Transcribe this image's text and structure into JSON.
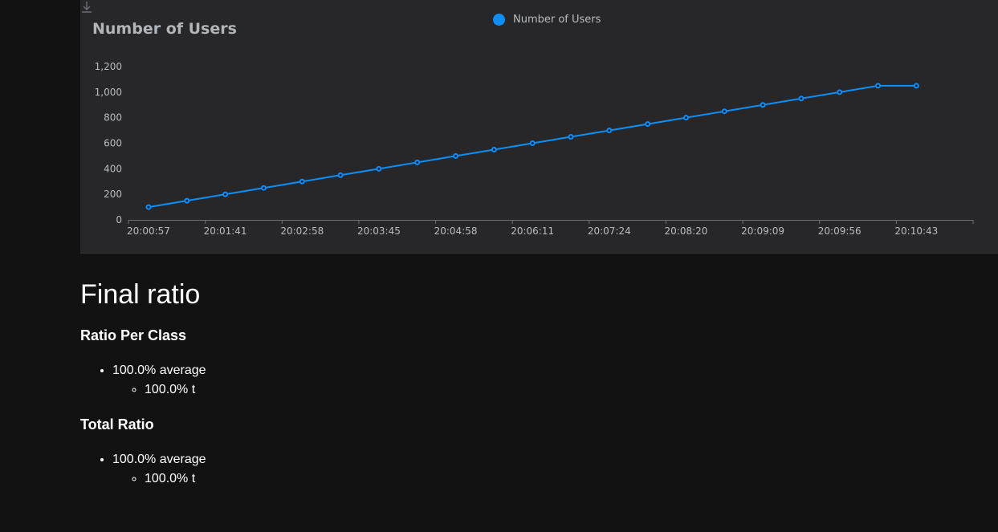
{
  "chart_panel": {
    "title": "Number of Users",
    "legend_label": "Number of Users",
    "download_icon": "download-icon"
  },
  "chart_data": {
    "type": "line",
    "title": "Number of Users",
    "xlabel": "",
    "ylabel": "",
    "series": [
      {
        "name": "Number of Users",
        "color": "#0e8ef7",
        "values": [
          100,
          150,
          200,
          250,
          300,
          350,
          400,
          450,
          500,
          550,
          600,
          650,
          700,
          750,
          800,
          850,
          900,
          950,
          1000,
          1050,
          1050
        ]
      }
    ],
    "x_tick_labels": [
      "20:00:57",
      "20:01:41",
      "20:02:58",
      "20:03:45",
      "20:04:58",
      "20:06:11",
      "20:07:24",
      "20:08:20",
      "20:09:09",
      "20:09:56",
      "20:10:43"
    ],
    "y_tick_labels": [
      "0",
      "200",
      "400",
      "600",
      "800",
      "1,000",
      "1,200"
    ],
    "ylim": [
      0,
      1200
    ],
    "grid": false,
    "legend": "top-center"
  },
  "report": {
    "heading": "Final ratio",
    "sections": [
      {
        "title": "Ratio Per Class",
        "item": "100.0% average",
        "subitem": "100.0% t"
      },
      {
        "title": "Total Ratio",
        "item": "100.0% average",
        "subitem": "100.0% t"
      }
    ]
  }
}
